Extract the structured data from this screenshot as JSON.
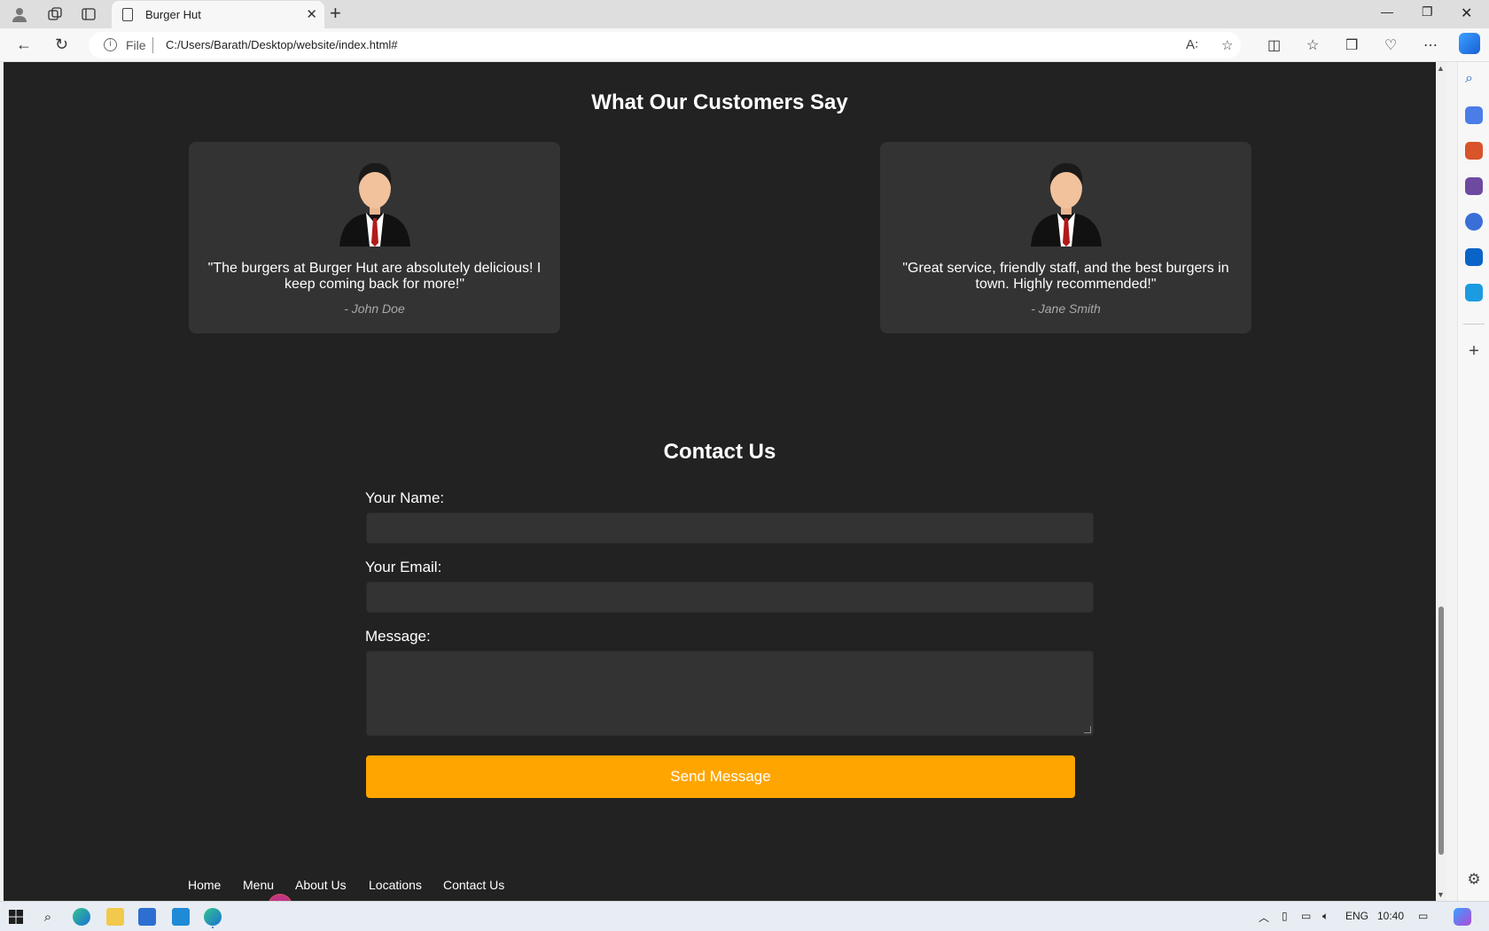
{
  "browser": {
    "tab_title": "Burger Hut",
    "file_label": "File",
    "url": "C:/Users/Barath/Desktop/website/index.html#"
  },
  "testimonials": {
    "heading": "What Our Customers Say",
    "items": [
      {
        "quote": "\"The burgers at Burger Hut are absolutely delicious! I keep coming back for more!\"",
        "author": "- John Doe"
      },
      {
        "quote": "\"Great service, friendly staff, and the best burgers in town. Highly recommended!\"",
        "author": "- Jane Smith"
      }
    ]
  },
  "contact": {
    "heading": "Contact Us",
    "name_label": "Your Name:",
    "email_label": "Your Email:",
    "message_label": "Message:",
    "name_value": "",
    "email_value": "",
    "message_value": "",
    "submit_label": "Send Message"
  },
  "footer": {
    "links": [
      "Home",
      "Menu",
      "About Us",
      "Locations",
      "Contact Us"
    ]
  },
  "taskbar": {
    "lang": "ENG",
    "time": "10:40"
  },
  "colors": {
    "page_bg": "#222222",
    "card_bg": "#333333",
    "accent": "#ffa500"
  }
}
